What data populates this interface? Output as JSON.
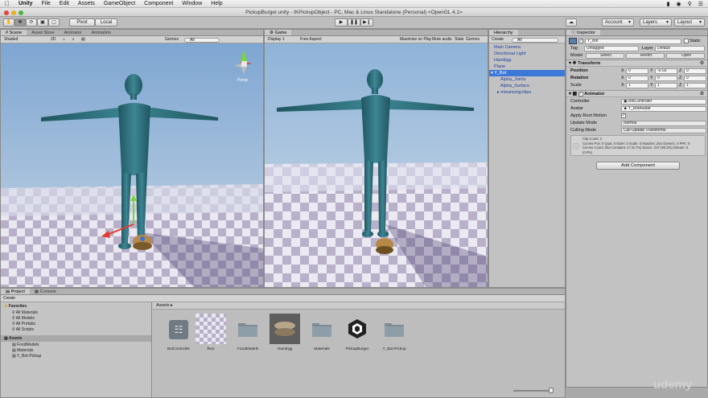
{
  "menubar": {
    "apple": "",
    "items": [
      "Unity",
      "File",
      "Edit",
      "Assets",
      "GameObject",
      "Component",
      "Window",
      "Help"
    ]
  },
  "window": {
    "title": "PickupBurger.unity - IKPickupObject - PC, Mac & Linux Standalone (Personal) <OpenGL 4.1>"
  },
  "toolbar": {
    "pivot": "Pivot",
    "local": "Local",
    "account": "Account",
    "layers": "Layers",
    "layout": "Layout"
  },
  "scene": {
    "tabs": [
      "Scene",
      "Asset Store",
      "Animator",
      "Animation"
    ],
    "shading": "Shaded",
    "mode2d": "2D",
    "gizmos": "Gizmos",
    "search_placeholder": "All",
    "persp": "Persp"
  },
  "game": {
    "tab": "Game",
    "display": "Display 1",
    "aspect": "Free Aspect",
    "maximize": "Maximize on Play",
    "mute": "Mute audio",
    "stats": "Stats",
    "gizmos": "Gizmos"
  },
  "hierarchy": {
    "tab": "Hierarchy",
    "create": "Create",
    "search_placeholder": "All",
    "items": [
      {
        "label": "Main Camera",
        "indent": 0,
        "selected": false
      },
      {
        "label": "Directional Light",
        "indent": 0,
        "selected": false
      },
      {
        "label": "HamEgg",
        "indent": 0,
        "selected": false
      },
      {
        "label": "Plane",
        "indent": 0,
        "selected": false
      },
      {
        "label": "Y_Bot",
        "indent": 0,
        "selected": true
      },
      {
        "label": "Alpha_Joints",
        "indent": 1,
        "selected": false
      },
      {
        "label": "Alpha_Surface",
        "indent": 1,
        "selected": false
      },
      {
        "label": "mixamorig:Hips",
        "indent": 1,
        "selected": false
      }
    ]
  },
  "inspector": {
    "tab": "Inspector",
    "object_name": "Y_Bot",
    "static": "Static",
    "tag_label": "Tag",
    "tag": "Untagged",
    "layer_label": "Layer",
    "layer": "Default",
    "model_label": "Model",
    "model_buttons": [
      "Select",
      "Revert",
      "Open"
    ],
    "transform": {
      "title": "Transform",
      "rows": [
        {
          "label": "Position",
          "x": "0",
          "y": "-0.03",
          "z": "0"
        },
        {
          "label": "Rotation",
          "x": "0",
          "y": "0",
          "z": "0"
        },
        {
          "label": "Scale",
          "x": "1",
          "y": "1",
          "z": "1"
        }
      ]
    },
    "animator": {
      "title": "Animator",
      "controller_label": "Controller",
      "controller": "BotController",
      "avatar_label": "Avatar",
      "avatar": "Y_BotAvatar",
      "root_motion_label": "Apply Root Motion",
      "update_label": "Update Mode",
      "update": "Normal",
      "culling_label": "Culling Mode",
      "culling": "Cull Update Transforms",
      "info": [
        "Clip Count: 2",
        "Curves Pos: 0 Quat: 0 Euler: 0 Scale: 0 Muscles: 254 Generic: 0 PPtr: 0",
        "Curves Count: 254 Constant: 17 (6.7%) Dense: 237 (93.3%) Stream: 0",
        "(0.0%)"
      ]
    },
    "add_component": "Add Component"
  },
  "project": {
    "tabs": [
      "Project",
      "Console"
    ],
    "create": "Create",
    "favorites_label": "Favorites",
    "favorites": [
      "All Materials",
      "All Models",
      "All Prefabs",
      "All Scripts"
    ],
    "assets_label": "Assets",
    "asset_tree": [
      "FoodModels",
      "Materials",
      "Y_Bot-Pickup"
    ],
    "breadcrumb": "Assets",
    "assets": [
      {
        "name": "BotController",
        "kind": "controller"
      },
      {
        "name": "floor",
        "kind": "texture"
      },
      {
        "name": "FoodModels",
        "kind": "folder"
      },
      {
        "name": "HamEgg",
        "kind": "model"
      },
      {
        "name": "Materials",
        "kind": "folder"
      },
      {
        "name": "PickupBurger",
        "kind": "unity"
      },
      {
        "name": "Y_Bot-Pickup",
        "kind": "folder"
      }
    ]
  },
  "watermark": "udemy",
  "colors": {
    "accent": "#3c78d8",
    "sky": "#8eb2d8",
    "robot": "#2f6f7c"
  }
}
